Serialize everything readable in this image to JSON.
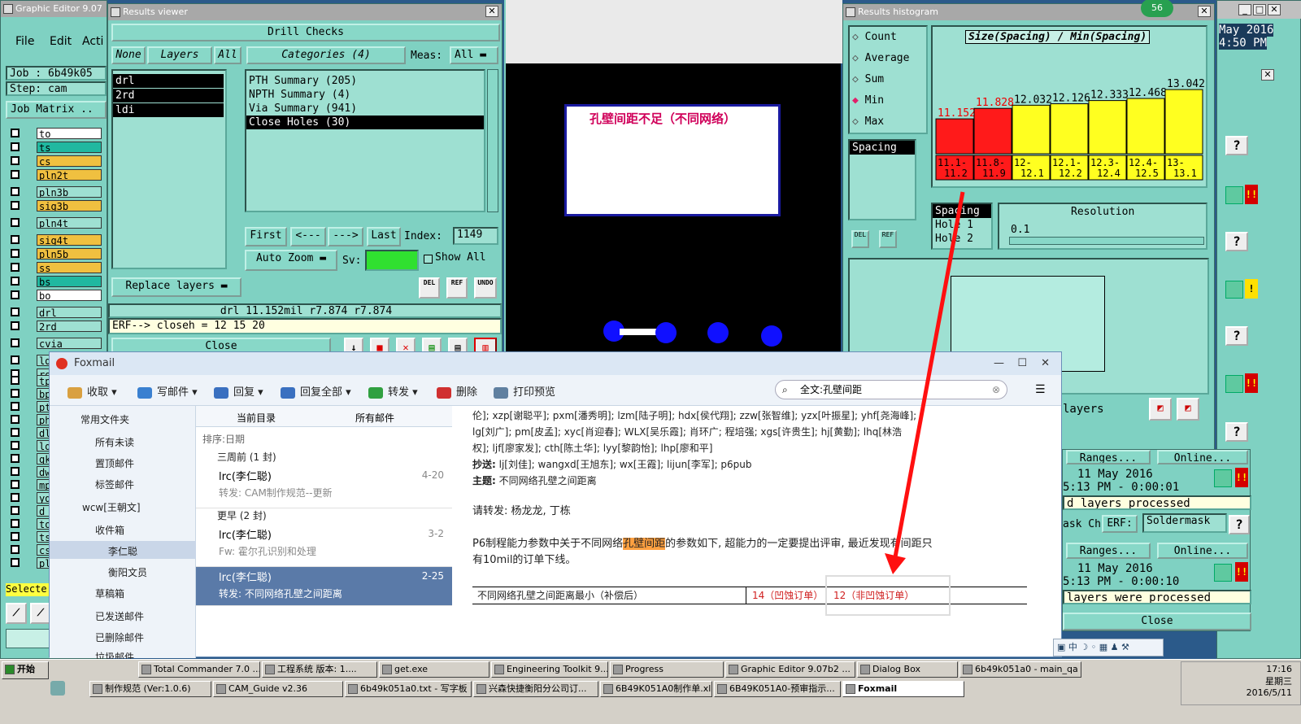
{
  "ge": {
    "title": "Graphic Editor 9.07",
    "menu": [
      "File",
      "Edit",
      "Acti"
    ],
    "job": "Job : 6b49k05",
    "step": "Step: cam",
    "job_matrix": "Job Matrix ..",
    "layers": [
      {
        "name": "to",
        "color": "#ffffff"
      },
      {
        "name": "ts",
        "color": "#20b8a0"
      },
      {
        "name": "cs",
        "color": "#f0c040"
      },
      {
        "name": "pln2t",
        "color": "#f0c040"
      },
      {
        "name": "pln3b",
        "color": "#9ee0d2"
      },
      {
        "name": "sig3b",
        "color": "#f0c040"
      },
      {
        "name": "pln4t",
        "color": "#9ee0d2"
      },
      {
        "name": "sig4t",
        "color": "#f0c040"
      },
      {
        "name": "pln5b",
        "color": "#f0c040"
      },
      {
        "name": "ss",
        "color": "#f0c040"
      },
      {
        "name": "bs",
        "color": "#20b8a0"
      },
      {
        "name": "bo",
        "color": "#ffffff"
      },
      {
        "name": "drl",
        "color": "#9ee0d2"
      },
      {
        "name": "2rd",
        "color": "#9ee0d2"
      },
      {
        "name": "cvia",
        "color": "#9ee0d2"
      },
      {
        "name": "ldi",
        "color": "#9ee0d2"
      },
      {
        "name": "ro",
        "color": "#9ee0d2"
      }
    ],
    "left_short": [
      "tp",
      "bp",
      "pt",
      "ph",
      "dl",
      "lg",
      "gk",
      "dw",
      "mp",
      "yd",
      "d",
      "to",
      "ts",
      "cs",
      "pl"
    ],
    "select_label": "Selecte"
  },
  "rv": {
    "title": "Results viewer",
    "drill_checks": "Drill Checks",
    "none": "None",
    "layers": "Layers",
    "all": "All",
    "categories": "Categories (4)",
    "meas": "Meas:",
    "meas_val": "All",
    "layer_list": [
      "drl",
      "2rd",
      "ldi"
    ],
    "cat_list": [
      "PTH Summary (205)",
      "NPTH Summary (4)",
      "Via Summary (941)",
      "Close Holes (30)"
    ],
    "first": "First",
    "prev": "<---",
    "next": "--->",
    "last": "Last",
    "index_label": "Index:",
    "index_val": "1149",
    "auto_zoom": "Auto Zoom",
    "sv": "Sv:",
    "show_all": "Show All",
    "replace_layers": "Replace layers",
    "status1": "drl 11.152mil  r7.874  r7.874",
    "status2": "ERF--> closeh = 12 15 20",
    "close": "Close",
    "del": "DEL",
    "ref": "REF",
    "undo": "UNDO"
  },
  "canvas": {
    "note": "孔壁间距不足（不同网络）"
  },
  "rh": {
    "title": "Results histogram",
    "badge": "56",
    "stats": [
      "Count",
      "Average",
      "Sum",
      "Min",
      "Max"
    ],
    "selected_stat": "Min",
    "chart_title": "Size(Spacing) / Min(Spacing)",
    "spacing": "Spacing",
    "hole1": "Hole 1",
    "hole2": "Hole 2",
    "spacing2": "Spacing",
    "resolution": "Resolution",
    "res_val": "0.1",
    "del": "DEL",
    "ref": "REF",
    "layers": "layers"
  },
  "chart_data": {
    "type": "bar",
    "title": "Size(Spacing) / Min(Spacing)",
    "values": [
      11.152,
      11.828,
      12.032,
      12.126,
      12.333,
      12.468,
      13.042
    ],
    "categories": [
      "11.1-11.2",
      "11.8-11.9",
      "12-12.1",
      "12.1-12.2",
      "12.3-12.4",
      "12.4-12.5",
      "13-13.1"
    ],
    "colors": [
      "#ff1a1a",
      "#ff1a1a",
      "#ffff20",
      "#ffff20",
      "#ffff20",
      "#ffff20",
      "#ffff20"
    ]
  },
  "right": {
    "date1": "May 2016",
    "time1": "4:50 PM",
    "ranges1": "Ranges...",
    "online1": "Online...",
    "date2": "11 May 2016",
    "time2": "5:13 PM - 0:00:01",
    "msg2": "d layers processed",
    "ask": "ask Ch",
    "erf": "ERF:",
    "soldermask": "Soldermask",
    "ranges2": "Ranges...",
    "online2": "Online...",
    "date3": "11 May 2016",
    "time3": "5:13 PM - 0:00:10",
    "msg3": "layers were processed",
    "close": "Close",
    "q": "?"
  },
  "fox": {
    "title": "Foxmail",
    "toolbar": [
      "收取",
      "写邮件",
      "回复",
      "回复全部",
      "转发",
      "删除",
      "打印预览"
    ],
    "search": "全文:孔壁间距",
    "nav": [
      "常用文件夹",
      "所有未读",
      "置顶邮件",
      "标签邮件",
      "wcw[王朝文]",
      "收件箱",
      "李仁聪",
      "衡阳文员",
      "草稿箱",
      "已发送邮件",
      "已删除邮件",
      "垃圾邮件"
    ],
    "tabs": [
      "当前目录",
      "所有邮件"
    ],
    "sort": "排序:日期",
    "group1": "三周前 (1 封)",
    "group2": "更早 (2 封)",
    "mails": [
      {
        "from": "lrc(李仁聪)",
        "date": "4-20",
        "subject": "转发: CAM制作规范--更新"
      },
      {
        "from": "lrc(李仁聪)",
        "date": "3-2",
        "subject": "Fw: 霍尔孔识别和处理"
      },
      {
        "from": "lrc(李仁聪)",
        "date": "2-25",
        "subject": "转发: 不同网络孔壁之间距离"
      }
    ],
    "body_cc1": "伦]; xzp[谢聪平]; pxm[潘秀明]; lzm[陆子明]; hdx[侯代翔]; zzw[张智维]; yzx[叶振星]; yhf[尧海峰];",
    "body_cc2": "lg[刘广]; pm[皮孟]; xyc[肖迎春]; WLX[吴乐霞]; 肖环广; 程培强; xgs[许贵生]; hj[黄勤]; lhq[林浩",
    "body_cc3": "权]; ljf[廖家发]; cth[陈土华]; lyy[黎韵怡]; lhp[廖和平]",
    "cc_label": "抄送:",
    "cc_val": "lj[刘佳]; wangxd[王旭东]; wx[王霞]; lijun[李军]; p6pub",
    "subj_label": "主题:",
    "subj_val": "不同网络孔壁之间距离",
    "greet": "请转发: 杨龙龙, 丁栋",
    "p1a": "P6制程能力参数中关于不同网络",
    "p1hl": "孔壁间距",
    "p1b": "的参数如下, 超能力的一定要提出评审, 最近发现有间距只",
    "p2": "有10mil的订单下线。",
    "table_label": "不同网络孔壁之间距离最小（补偿后）",
    "table_v1": "14（凹蚀订单）",
    "table_v2": "12（非凹蚀订单）"
  },
  "taskbar": {
    "start": "开始",
    "row1": [
      "Total Commander 7.0 ...",
      "工程系统  版本: 1....",
      "get.exe",
      "Engineering Toolkit 9....",
      "Progress",
      "Graphic Editor 9.07b2 ...",
      "Dialog Box",
      "6b49k051a0 - main_qa"
    ],
    "row2": [
      "制作规范 (Ver:1.0.6)",
      "CAM_Guide v2.36",
      "6b49k051a0.txt - 写字板",
      "兴森快捷衡阳分公司订...",
      "6B49K051A0制作单.xls ...",
      "6B49K051A0-预审指示...",
      "Foxmail"
    ],
    "time": "17:16",
    "day": "星期三",
    "date": "2016/5/11"
  }
}
